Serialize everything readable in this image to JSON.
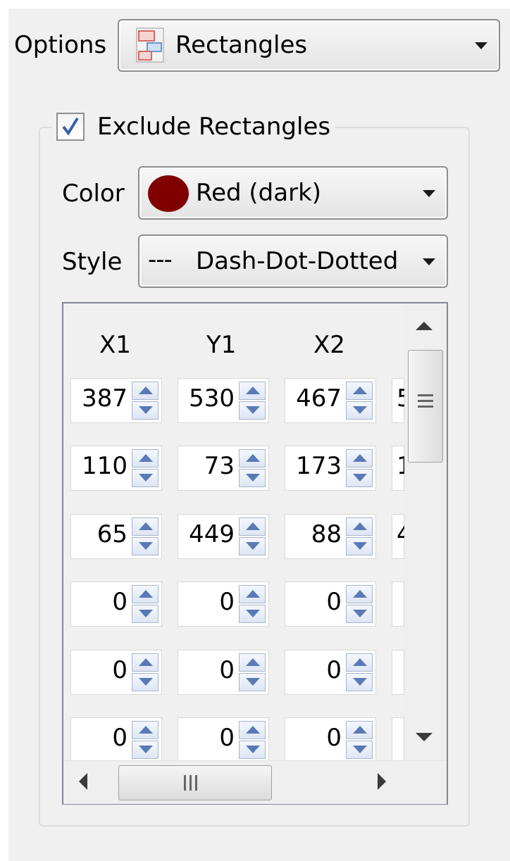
{
  "options": {
    "label": "Options",
    "selected": "Rectangles",
    "icon": "rectangles-icon"
  },
  "group": {
    "checkbox_label": "Exclude Rectangles",
    "checked": true
  },
  "color": {
    "label": "Color",
    "selected": "Red (dark)",
    "swatch": "#800000"
  },
  "style": {
    "label": "Style",
    "selected": "Dash-Dot-Dotted",
    "preview": "---"
  },
  "table": {
    "headers": [
      "X1",
      "Y1",
      "X2"
    ],
    "rows": [
      [
        "387",
        "530",
        "467",
        "5"
      ],
      [
        "110",
        "73",
        "173",
        "1"
      ],
      [
        "65",
        "449",
        "88",
        "4"
      ],
      [
        "0",
        "0",
        "0",
        ""
      ],
      [
        "0",
        "0",
        "0",
        ""
      ],
      [
        "0",
        "0",
        "0",
        ""
      ]
    ]
  },
  "scrollbars": {
    "grip_v": "≡",
    "grip_h": "III"
  }
}
